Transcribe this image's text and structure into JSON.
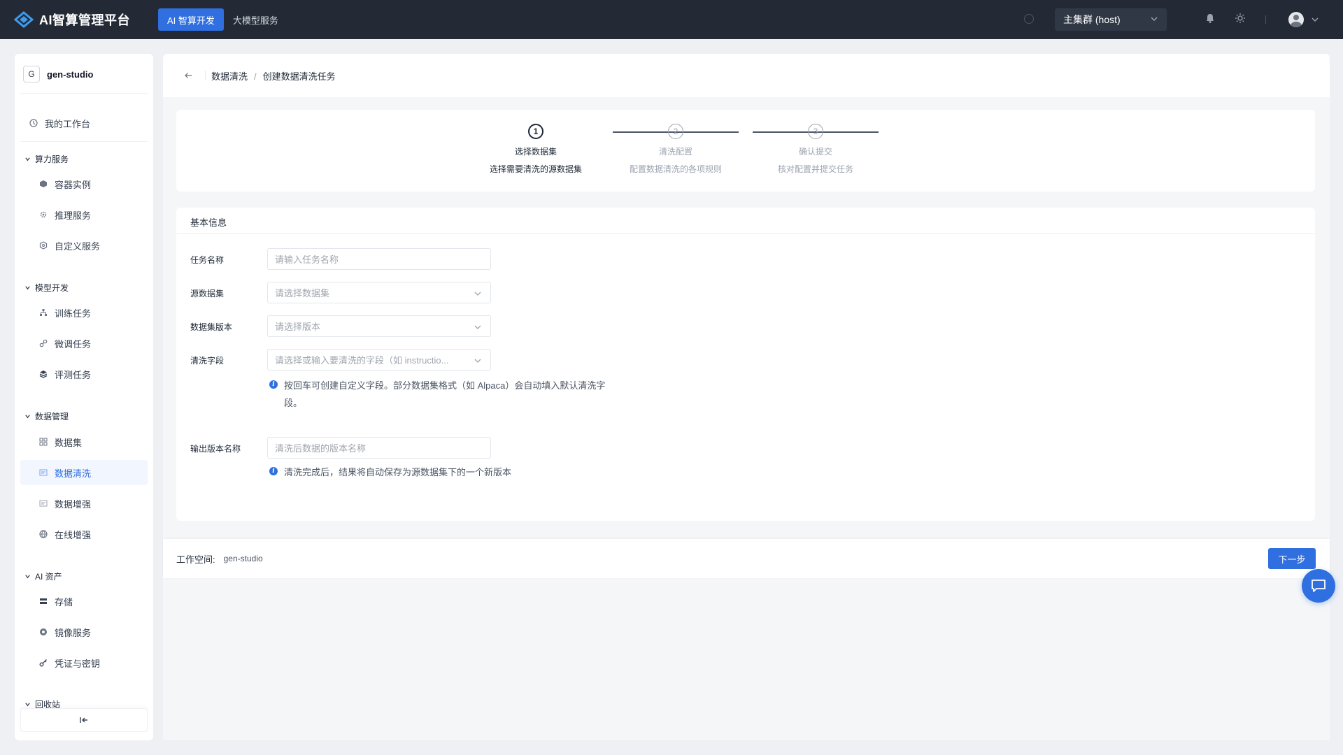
{
  "app": {
    "title": "AI智算管理平台"
  },
  "topnav": [
    {
      "label": "AI 智算开发",
      "active": true
    },
    {
      "label": "大模型服务",
      "active": false
    }
  ],
  "cluster": {
    "label": "主集群 (host)"
  },
  "workspace": {
    "badge": "G",
    "name": "gen-studio"
  },
  "sidebar": {
    "top_item": "我的工作台",
    "groups": [
      {
        "label": "算力服务",
        "items": [
          "容器实例",
          "推理服务",
          "自定义服务"
        ]
      },
      {
        "label": "模型开发",
        "items": [
          "训练任务",
          "微调任务",
          "评测任务"
        ]
      },
      {
        "label": "数据管理",
        "items": [
          "数据集",
          "数据清洗",
          "数据增强",
          "在线增强"
        ]
      },
      {
        "label": "AI 资产",
        "items": [
          "存储",
          "镜像服务",
          "凭证与密钥"
        ]
      },
      {
        "label": "回收站",
        "items": []
      }
    ],
    "active_item": "数据清洗"
  },
  "breadcrumb": {
    "parent": "数据清洗",
    "separator": "/",
    "current": "创建数据清洗任务"
  },
  "steps": [
    {
      "num": "1",
      "title": "选择数据集",
      "desc": "选择需要清洗的源数据集"
    },
    {
      "num": "2",
      "title": "清洗配置",
      "desc": "配置数据清洗的各项规则"
    },
    {
      "num": "3",
      "title": "确认提交",
      "desc": "核对配置并提交任务"
    }
  ],
  "form": {
    "section_title": "基本信息",
    "task_name": {
      "label": "任务名称",
      "placeholder": "请输入任务名称"
    },
    "source_dataset": {
      "label": "源数据集",
      "placeholder": "请选择数据集"
    },
    "dataset_version": {
      "label": "数据集版本",
      "placeholder": "请选择版本"
    },
    "clean_fields": {
      "label": "清洗字段",
      "placeholder": "请选择或输入要清洗的字段（如 instructio...",
      "hint": "按回车可创建自定义字段。部分数据集格式（如 Alpaca）会自动填入默认清洗字段。"
    },
    "output_version": {
      "label": "输出版本名称",
      "placeholder": "清洗后数据的版本名称",
      "hint": "清洗完成后，结果将自动保存为源数据集下的一个新版本"
    }
  },
  "footer": {
    "workspace_label": "工作空间:",
    "workspace_value": "gen-studio",
    "next_label": "下一步"
  },
  "colors": {
    "topbar": "#232a36",
    "accent": "#2f6fe0",
    "page_bg": "#eef0f4"
  }
}
